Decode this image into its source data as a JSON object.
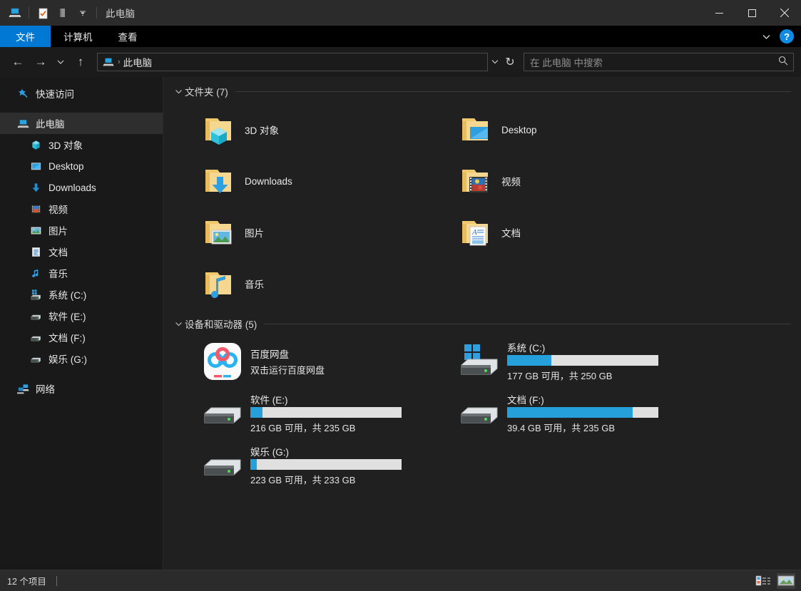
{
  "window": {
    "title": "此电脑",
    "quick_access_icons": [
      "computer-icon",
      "properties-checkmark-icon",
      "new-folder-icon",
      "customize-chevron-icon"
    ],
    "controls": {
      "minimize": "—",
      "maximize": "▢",
      "close": "✕"
    }
  },
  "ribbon": {
    "tabs": [
      {
        "label": "文件",
        "active": true
      },
      {
        "label": "计算机",
        "active": false
      },
      {
        "label": "查看",
        "active": false
      }
    ],
    "collapse_label": "⌄",
    "help_label": "?"
  },
  "address": {
    "back": "←",
    "forward": "→",
    "recent": "⌄",
    "up": "↑",
    "path_text": "此电脑",
    "path_separator": "›",
    "dropdown": "⌄",
    "refresh": "↻",
    "search_placeholder": "在 此电脑 中搜索",
    "search_icon": "search-icon"
  },
  "sidebar": {
    "items": [
      {
        "label": "快速访问",
        "icon": "star-pin-icon",
        "level": 0,
        "selected": false
      },
      {
        "label": "此电脑",
        "icon": "computer-icon",
        "level": 0,
        "selected": true
      },
      {
        "label": "3D 对象",
        "icon": "cube-icon",
        "level": 1,
        "selected": false
      },
      {
        "label": "Desktop",
        "icon": "desktop-icon",
        "level": 1,
        "selected": false
      },
      {
        "label": "Downloads",
        "icon": "download-arrow-icon",
        "level": 1,
        "selected": false
      },
      {
        "label": "视频",
        "icon": "video-filmstrip-icon",
        "level": 1,
        "selected": false
      },
      {
        "label": "图片",
        "icon": "picture-icon",
        "level": 1,
        "selected": false
      },
      {
        "label": "文档",
        "icon": "document-icon",
        "level": 1,
        "selected": false
      },
      {
        "label": "音乐",
        "icon": "music-note-icon",
        "level": 1,
        "selected": false
      },
      {
        "label": "系统 (C:)",
        "icon": "windows-drive-icon",
        "level": 1,
        "selected": false
      },
      {
        "label": "软件 (E:)",
        "icon": "drive-icon",
        "level": 1,
        "selected": false
      },
      {
        "label": "文档 (F:)",
        "icon": "drive-icon",
        "level": 1,
        "selected": false
      },
      {
        "label": "娱乐 (G:)",
        "icon": "drive-icon",
        "level": 1,
        "selected": false
      },
      {
        "label": "网络",
        "icon": "network-icon",
        "level": 0,
        "selected": false
      }
    ]
  },
  "content": {
    "folders_group": {
      "title": "文件夹 (7)",
      "chevron": "⌄",
      "items": [
        {
          "label": "3D 对象",
          "icon": "folder-3d-objects-icon"
        },
        {
          "label": "Desktop",
          "icon": "folder-desktop-icon"
        },
        {
          "label": "Downloads",
          "icon": "folder-downloads-icon"
        },
        {
          "label": "视频",
          "icon": "folder-videos-icon"
        },
        {
          "label": "图片",
          "icon": "folder-pictures-icon"
        },
        {
          "label": "文档",
          "icon": "folder-documents-icon"
        },
        {
          "label": "音乐",
          "icon": "folder-music-icon"
        }
      ]
    },
    "devices_group": {
      "title": "设备和驱动器 (5)",
      "chevron": "⌄",
      "app_item": {
        "label": "百度网盘",
        "sublabel": "双击运行百度网盘",
        "icon": "baidu-netdisk-icon"
      },
      "drives": [
        {
          "label": "系统 (C:)",
          "free_text": "177 GB 可用，共 250 GB",
          "used_percent": 29.2,
          "icon": "windows-drive-icon"
        },
        {
          "label": "软件 (E:)",
          "free_text": "216 GB 可用，共 235 GB",
          "used_percent": 8.1,
          "icon": "drive-icon"
        },
        {
          "label": "文档 (F:)",
          "free_text": "39.4 GB 可用，共 235 GB",
          "used_percent": 83.2,
          "icon": "drive-icon"
        },
        {
          "label": "娱乐 (G:)",
          "free_text": "223 GB 可用，共 233 GB",
          "used_percent": 4.3,
          "icon": "drive-icon"
        }
      ]
    }
  },
  "statusbar": {
    "item_count": "12 个项目",
    "view_details_icon": "details-view-icon",
    "view_large_icons_icon": "large-icons-view-icon"
  },
  "colors": {
    "accent": "#0078d4",
    "bar_fill": "#26a0da",
    "bar_track": "#e0e0e0",
    "titlebar_bg": "#2b2b2b",
    "sidebar_bg": "#191919",
    "content_bg": "#202020",
    "selected_bg": "#2e2e2e"
  }
}
